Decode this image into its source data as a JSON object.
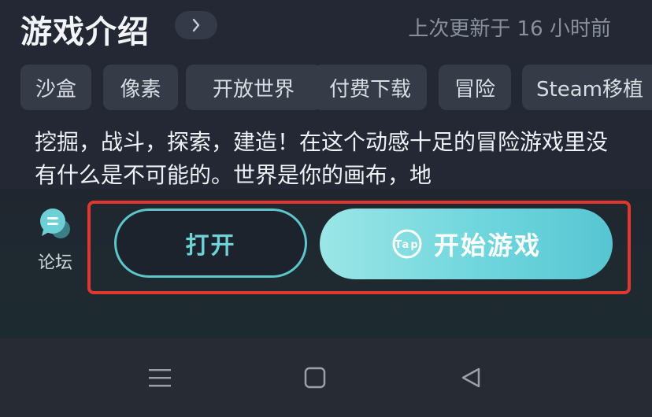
{
  "header": {
    "title": "游戏介绍",
    "updated_text": "上次更新于 16 小时前"
  },
  "tags": [
    "沙盒",
    "像素",
    "开放世界",
    "付费下载",
    "冒险",
    "Steam移植"
  ],
  "description": "挖掘，战斗，探索，建造！在这个动感十足的冒险游戏里没有什么是不可能的。世界是你的画布，地",
  "footer": {
    "forum_label": "论坛",
    "open_label": "打开",
    "start_label": "开始游戏",
    "tap_logo_text": "Tap"
  },
  "icons": {
    "more": "chevron-right-icon",
    "forum": "chat-bubble-icon",
    "start": "tap-logo-icon",
    "nav_menu": "menu-icon",
    "nav_home": "square-home-icon",
    "nav_back": "triangle-back-icon"
  },
  "colors": {
    "accent": "#5cc6cb",
    "highlight": "#e0382e",
    "background": "#232834"
  }
}
